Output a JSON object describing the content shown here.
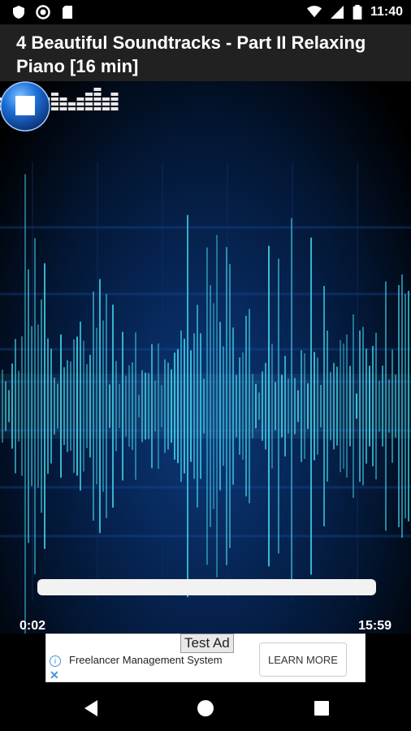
{
  "status_bar": {
    "time": "11:40",
    "left_icons": [
      "shield-icon",
      "record-icon",
      "sd-card-icon"
    ],
    "right_icons": [
      "wifi-icon",
      "signal-icon",
      "battery-icon"
    ]
  },
  "title": "4 Beautiful Soundtracks - Part II Relaxing Piano [16 min]",
  "player": {
    "current_time": "0:02",
    "total_time": "15:59",
    "progress_fraction": 0.002,
    "controls": [
      "equalizer-icon",
      "stop-button"
    ]
  },
  "ad": {
    "badge": "Test Ad",
    "text": "Freelancer Management System",
    "cta": "LEARN MORE"
  },
  "nav": [
    "back-button",
    "home-button",
    "recents-button"
  ],
  "colors": {
    "title_bar_bg": "#212121",
    "accent_blue": "#1e6fd9",
    "wave_cyan": "#3fd0e6"
  }
}
